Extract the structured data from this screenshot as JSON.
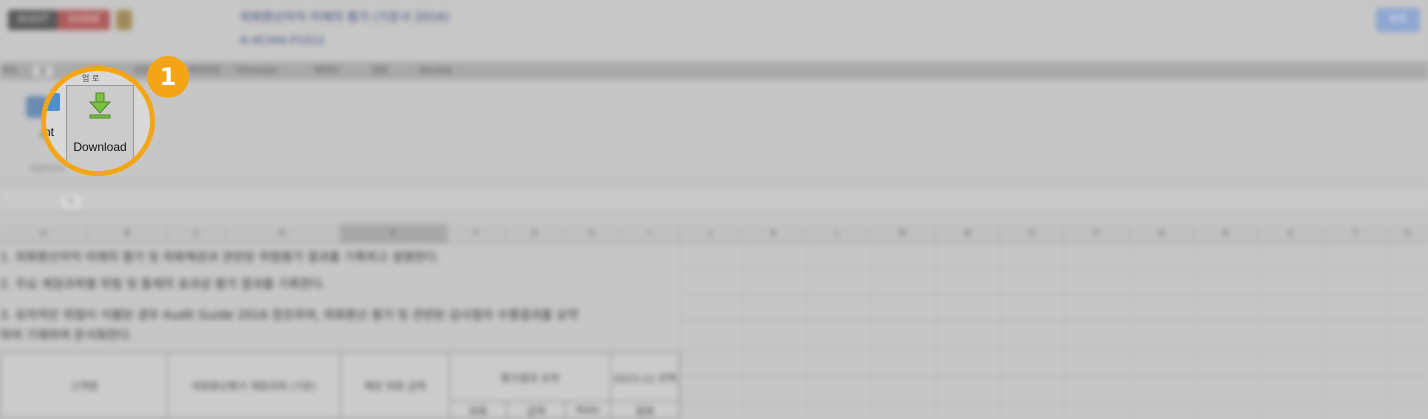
{
  "header": {
    "logo_text_left": "AUDIT",
    "logo_text_right": "GUIDE",
    "doc_title": "외화환산차익 미래의 평가 (기준서 2016)",
    "doc_subtitle": "A-45344-P1012",
    "action_button": "공유"
  },
  "ribbon": {
    "tabs": [
      "File",
      "홈",
      "삽입",
      "레이아웃",
      "Formulas",
      "데이터",
      "검토",
      "Review"
    ],
    "left_item_label": "nt",
    "group_label": "Options"
  },
  "formula_bar": {
    "fx": "fx"
  },
  "sheet": {
    "columns": [
      "A",
      "B",
      "C",
      "D",
      "E",
      "F",
      "G",
      "H",
      "I",
      "J",
      "K",
      "L",
      "M",
      "N",
      "O",
      "P",
      "Q",
      "R",
      "S",
      "T",
      "U"
    ],
    "lines": [
      "1. 외화환산차익 미래의 평가 및 외화채권과 관련된 위험평가 결과를 기록하고 설명한다.",
      "2. 주요 계정과목별 위험 및 통제의 효과성 평가 결과를 기록한다.",
      "3. 유의적인 위험이 식별된 경우 Audit Guide 2016 참조하여, 외화환산 평가 및 관련된 감사절차 수행결과를 요약",
      "하여 기재하여 문서화한다."
    ],
    "table": {
      "h1": "고객명",
      "h2": "외화환산평가 계정과목 (기준)",
      "h3": "해당 외화 금액",
      "h4": "평가결과 요약",
      "h5": "2023.12 잔액",
      "sub": [
        "외화",
        "금액",
        "Rate",
        "원화"
      ]
    }
  },
  "callout": {
    "number": "1",
    "download_label": "Download",
    "top_fragment": "업 로"
  }
}
